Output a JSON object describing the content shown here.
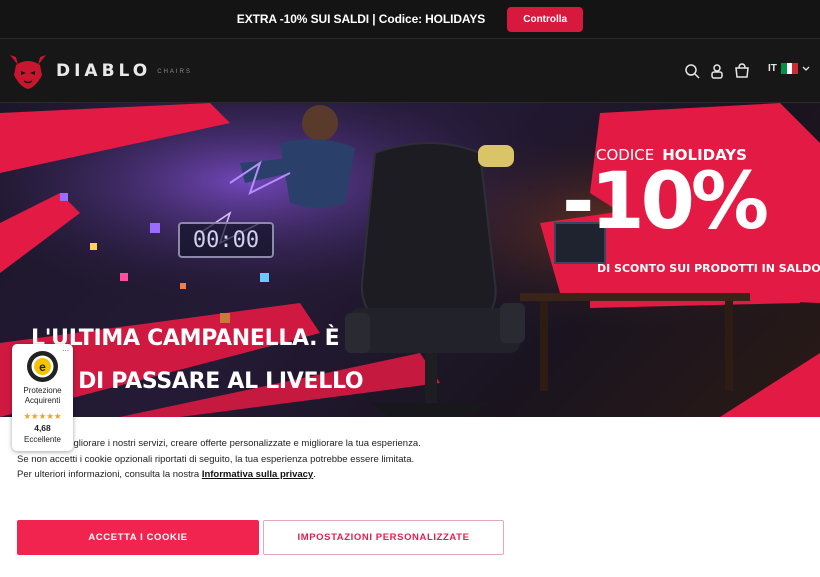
{
  "promo": {
    "text": "EXTRA -10% SUI SALDI | Codice:",
    "code": "HOLIDAYS",
    "button_label": "Controlla"
  },
  "header": {
    "logo_word": "DIABLO",
    "logo_sub": "CHAIRS",
    "icons": [
      "search-icon",
      "user-icon",
      "cart-icon"
    ],
    "language": "IT",
    "flag_colors": [
      "#009246",
      "#ffffff",
      "#ce2b37"
    ]
  },
  "hero": {
    "timer": "00:00",
    "headline_line1": "L'ULTIMA CAMPANELLA. È",
    "headline_line2": "A DI PASSARE AL LIVELLO",
    "codice_label": "CODICE",
    "codice_value": "HOLIDAYS",
    "discount": "-10%",
    "discount_sub": "DI SCONTO SUI PRODOTTI IN SALDO"
  },
  "cookie": {
    "text": "cookie per migliorare i nostri servizi, creare offerte personalizzate e migliorare la tua esperienza. Se non accetti i cookie opzionali riportati di seguito, la tua esperienza potrebbe essere limitata. Per ulteriori informazioni, consulta la nostra",
    "link": "Informativa sulla privacy",
    "link_end": ".",
    "accept_label": "ACCETTA I COOKIE",
    "settings_label": "IMPOSTAZIONI PERSONALIZZATE"
  },
  "trust_badge": {
    "more": "...",
    "label": "Protezione Acquirenti",
    "stars": "★★★★★",
    "rating": "4,68",
    "rating_label": "Eccellente"
  },
  "colors": {
    "accent": "#f0244f",
    "brand_red": "#d6193c",
    "dark": "#171717"
  }
}
